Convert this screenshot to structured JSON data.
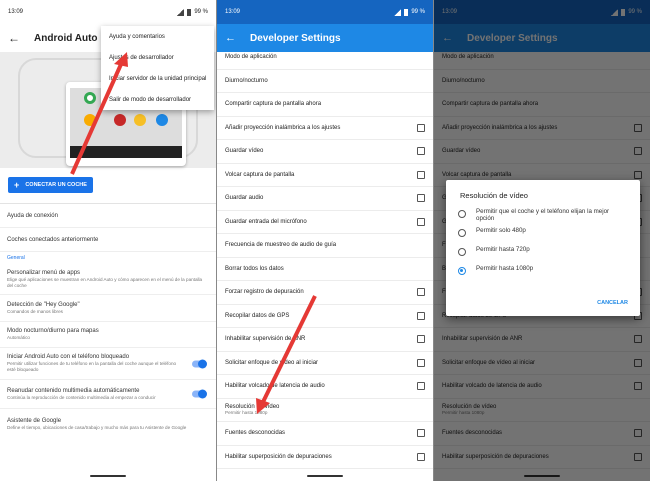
{
  "panels": {
    "android_auto": {
      "status_time": "13:09",
      "status_battery": "99 %",
      "title": "Android Auto",
      "menu": [
        "Ayuda y comentarios",
        "Ajustes de desarrollador",
        "Iniciar servidor de la unidad principal",
        "Salir de modo de desarrollador"
      ],
      "connect_button": "CONECTAR UN COCHE",
      "items_top": [
        "Ayuda de conexión",
        "Coches conectados anteriormente"
      ],
      "section_general": "General",
      "items": [
        {
          "title": "Personalizar menú de apps",
          "sub": "Elige qué aplicaciones se muestran en Android Auto y cómo aparecen en el menú de la pantalla del coche"
        },
        {
          "title": "Detección de \"Hey Google\"",
          "sub": "Comandos de manos libres"
        },
        {
          "title": "Modo nocturno/diurno para mapas",
          "sub": "Automático"
        },
        {
          "title": "Iniciar Android Auto con el teléfono bloqueado",
          "sub": "Permitir utilizar funciones de tu teléfono en la pantalla del coche aunque el teléfono esté bloqueado",
          "toggle": true
        },
        {
          "title": "Reanudar contenido multimedia automáticamente",
          "sub": "Continúa la reproducción de contenido multimedia al empezar a conducir",
          "toggle": true
        },
        {
          "title": "Asistente de Google",
          "sub": "Define el tiempo, ubicaciones de casa/trabajo y mucho más para tu Asistente de Google"
        }
      ]
    },
    "developer": {
      "status_time": "13:09",
      "status_battery": "99 %",
      "title": "Developer Settings",
      "items": [
        {
          "title": "Modo de aplicación",
          "cb": false
        },
        {
          "title": "Diurno/nocturno",
          "cb": false
        },
        {
          "title": "Compartir captura de pantalla ahora",
          "cb": false
        },
        {
          "title": "Añadir proyección inalámbrica a los ajustes",
          "cb": true
        },
        {
          "title": "Guardar vídeo",
          "cb": true
        },
        {
          "title": "Volcar captura de pantalla",
          "cb": true
        },
        {
          "title": "Guardar audio",
          "cb": true
        },
        {
          "title": "Guardar entrada del micrófono",
          "cb": true
        },
        {
          "title": "Frecuencia de muestreo de audio de guía",
          "cb": false
        },
        {
          "title": "Borrar todos los datos",
          "cb": false
        },
        {
          "title": "Forzar registro de depuración",
          "cb": true
        },
        {
          "title": "Recopilar datos de GPS",
          "cb": true
        },
        {
          "title": "Inhabilitar supervisión de ANR",
          "cb": true
        },
        {
          "title": "Solicitar enfoque de vídeo al iniciar",
          "cb": true
        },
        {
          "title": "Habilitar volcado de latencia de audio",
          "cb": true
        },
        {
          "title": "Resolución de vídeo",
          "sub": "Permitir hasta 1080p",
          "cb": false
        },
        {
          "title": "Fuentes desconocidas",
          "cb": true
        },
        {
          "title": "Habilitar superposición de depuraciones",
          "cb": true
        }
      ]
    },
    "dialog": {
      "title": "Resolución de vídeo",
      "options": [
        "Permitir que el coche y el teléfono elijan la mejor opción",
        "Permitir solo 480p",
        "Permitir hasta 720p",
        "Permitir hasta 1080p"
      ],
      "selected_index": 3,
      "cancel": "CANCELAR"
    }
  },
  "colors": {
    "accent": "#1e88e5",
    "arrow": "#e53935"
  }
}
